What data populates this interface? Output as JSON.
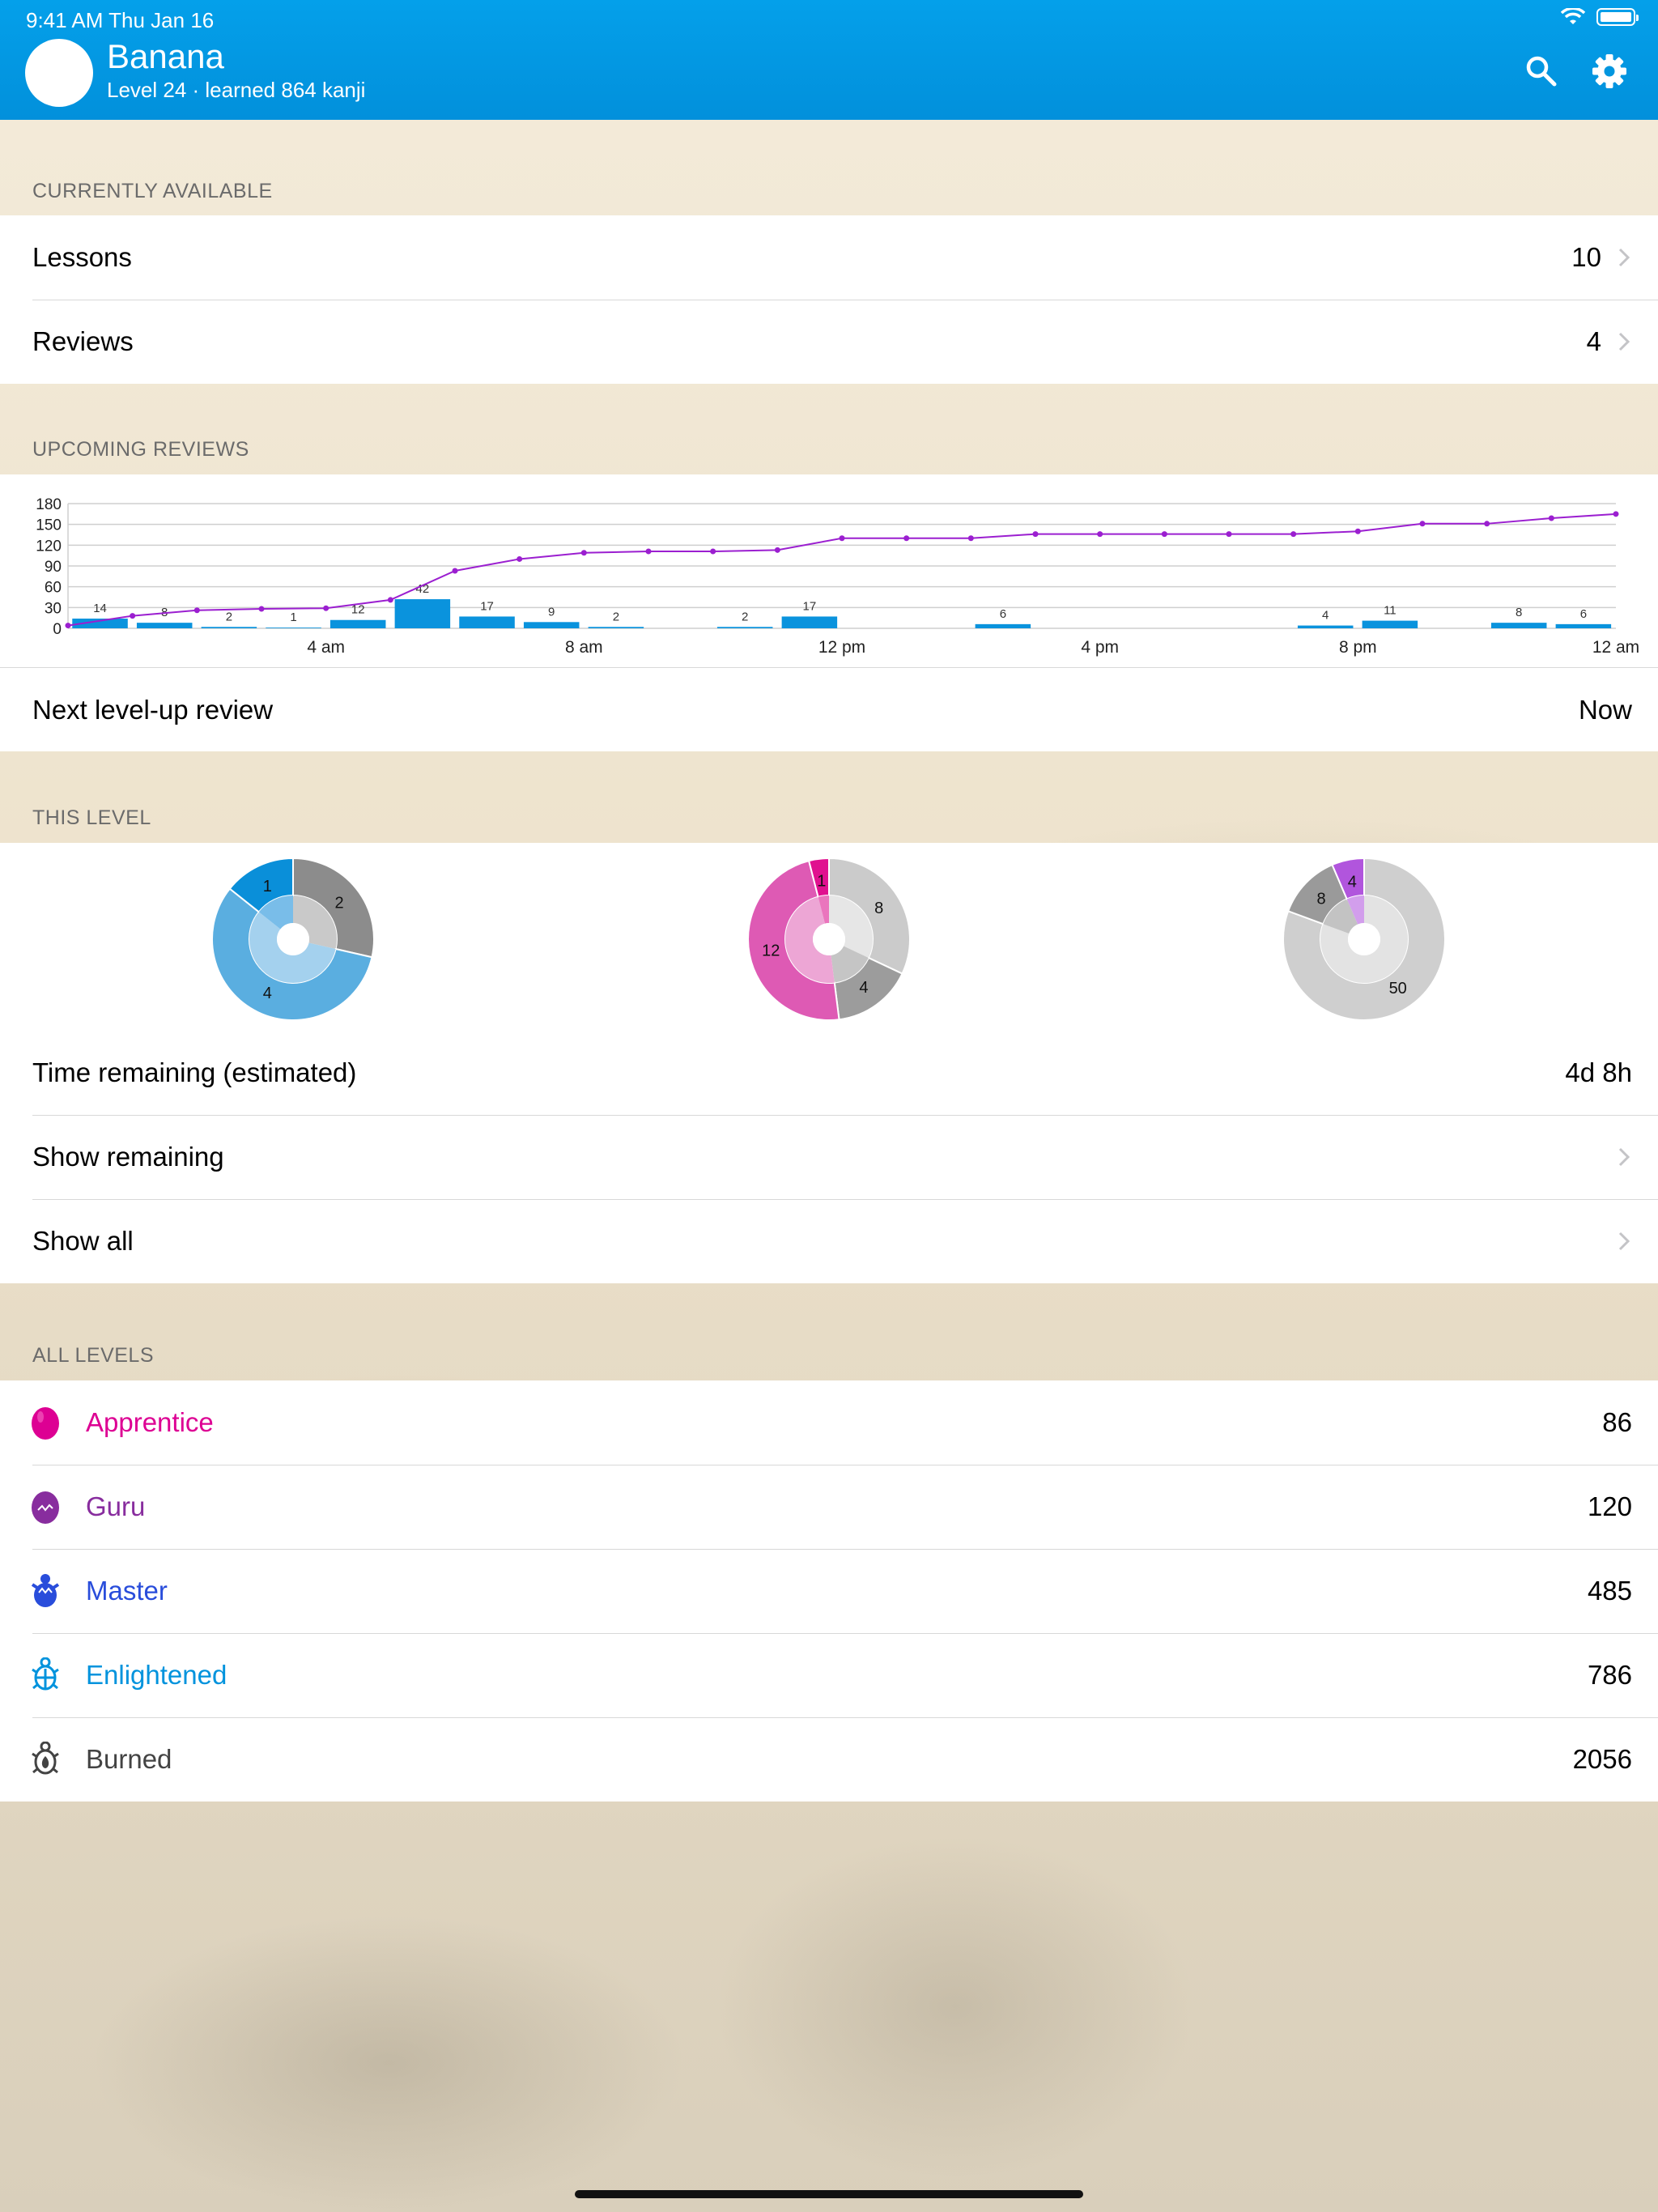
{
  "status_bar": {
    "time": "9:41 AM   Thu Jan 16"
  },
  "header": {
    "name": "Banana",
    "subtitle": "Level 24 · learned 864 kanji",
    "search_icon": "search-icon",
    "settings_icon": "gear-icon"
  },
  "available": {
    "title": "CURRENTLY AVAILABLE",
    "rows": [
      {
        "label": "Lessons",
        "value": "10"
      },
      {
        "label": "Reviews",
        "value": "4"
      }
    ]
  },
  "upcoming": {
    "title": "UPCOMING REVIEWS",
    "next_label": "Next level-up review",
    "next_value": "Now"
  },
  "chart_data": {
    "type": "bar",
    "title": "",
    "bar_color": "#0a93dd",
    "line_color": "#9b1fd0",
    "ylim": [
      0,
      180
    ],
    "yticks": [
      "0",
      "30",
      "60",
      "90",
      "120",
      "150",
      "180"
    ],
    "x_tick_labels": [
      {
        "label": "4 am",
        "slot": 4
      },
      {
        "label": "8 am",
        "slot": 8
      },
      {
        "label": "12 pm",
        "slot": 12
      },
      {
        "label": "4 pm",
        "slot": 16
      },
      {
        "label": "8 pm",
        "slot": 20
      },
      {
        "label": "12 am",
        "slot": 24
      }
    ],
    "bars": [
      14,
      8,
      2,
      1,
      12,
      42,
      17,
      9,
      2,
      0,
      2,
      17,
      0,
      0,
      6,
      0,
      0,
      0,
      0,
      4,
      11,
      0,
      8,
      6
    ],
    "cumulative": [
      4,
      18,
      26,
      28,
      29,
      41,
      83,
      100,
      109,
      111,
      111,
      113,
      130,
      130,
      130,
      136,
      136,
      136,
      136,
      136,
      140,
      151,
      151,
      159,
      165
    ]
  },
  "this_level": {
    "title": "THIS LEVEL",
    "pies": [
      {
        "slices": [
          {
            "value": 2,
            "color": "#8c8c8c",
            "label": "2"
          },
          {
            "value": 4,
            "color": "#5aaee0",
            "label": "4"
          },
          {
            "value": 1,
            "color": "#0a8fd9",
            "label": "1"
          }
        ],
        "inner": [
          {
            "value": 2,
            "color": "#c9c9c9"
          },
          {
            "value": 4,
            "color": "#a4d1ee"
          },
          {
            "value": 1,
            "color": "#79bde9"
          }
        ]
      },
      {
        "slices": [
          {
            "value": 8,
            "color": "#cbcbcb",
            "label": "8"
          },
          {
            "value": 4,
            "color": "#9c9c9c",
            "label": "4"
          },
          {
            "value": 12,
            "color": "#de5ab4",
            "label": "12"
          },
          {
            "value": 1,
            "color": "#e0118f",
            "label": "1"
          }
        ],
        "inner": [
          {
            "value": 8,
            "color": "#e6e6e6"
          },
          {
            "value": 4,
            "color": "#c5c5c5"
          },
          {
            "value": 12,
            "color": "#eda6d5"
          },
          {
            "value": 1,
            "color": "#ea75bd"
          }
        ]
      },
      {
        "slices": [
          {
            "value": 50,
            "color": "#cfcfcf",
            "label": "50"
          },
          {
            "value": 8,
            "color": "#9a9a9a",
            "label": "8"
          },
          {
            "value": 4,
            "color": "#b155dd",
            "label": "4"
          }
        ],
        "inner": [
          {
            "value": 50,
            "color": "#e3e3e3"
          },
          {
            "value": 8,
            "color": "#c3c3c3"
          },
          {
            "value": 4,
            "color": "#d29eec"
          }
        ]
      }
    ],
    "rows": [
      {
        "label": "Time remaining (estimated)",
        "value": "4d 8h"
      },
      {
        "label": "Show remaining",
        "value": ""
      },
      {
        "label": "Show all",
        "value": ""
      }
    ]
  },
  "all_levels": {
    "title": "ALL LEVELS",
    "rows": [
      {
        "label": "Apprentice",
        "value": "86",
        "color": "#dd0093",
        "icon": "apprentice-egg-icon"
      },
      {
        "label": "Guru",
        "value": "120",
        "color": "#882d9e",
        "icon": "guru-hatching-egg-icon"
      },
      {
        "label": "Master",
        "value": "485",
        "color": "#294ddb",
        "icon": "master-baby-turtle-icon"
      },
      {
        "label": "Enlightened",
        "value": "786",
        "color": "#0093dd",
        "icon": "enlightened-turtle-icon"
      },
      {
        "label": "Burned",
        "value": "2056",
        "color": "#434343",
        "icon": "burned-turtle-icon"
      }
    ]
  }
}
